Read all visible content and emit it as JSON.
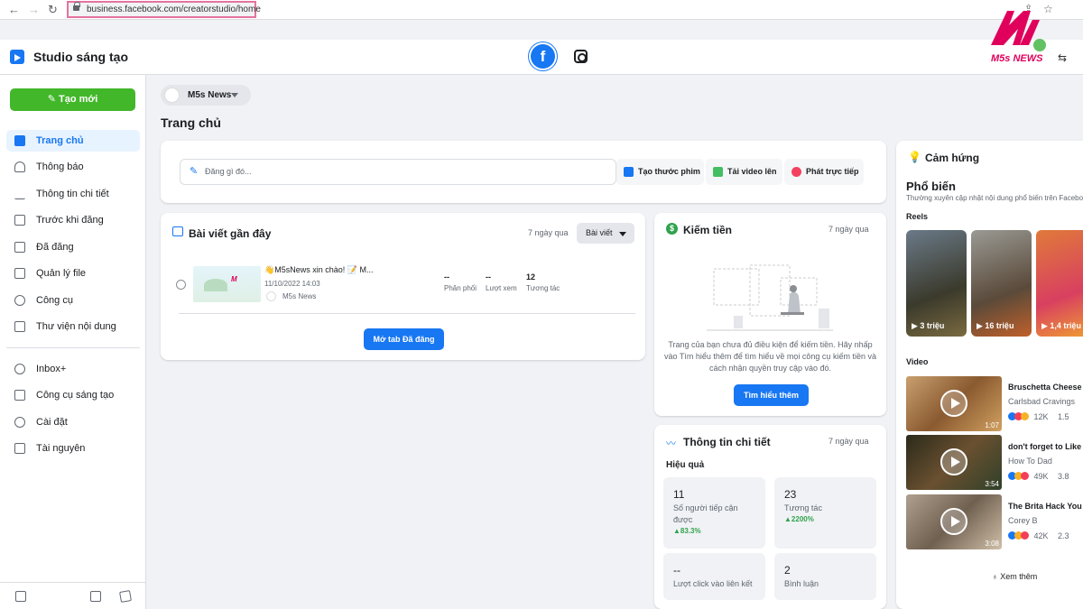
{
  "browser": {
    "url": "business.facebook.com/creatorstudio/home"
  },
  "header": {
    "title": "Studio sáng tạo",
    "brand": "M5s NEWS"
  },
  "sidebar": {
    "create_label": "Tạo mới",
    "items": [
      {
        "label": "Trang chủ",
        "icon": "home-icon"
      },
      {
        "label": "Thông báo",
        "icon": "bell-icon"
      },
      {
        "label": "Thông tin chi tiết",
        "icon": "chart-line-icon"
      },
      {
        "label": "Trước khi đăng",
        "icon": "document-icon"
      },
      {
        "label": "Đã đăng",
        "icon": "calendar-icon"
      },
      {
        "label": "Quản lý file",
        "icon": "file-icon"
      },
      {
        "label": "Công cụ",
        "icon": "tools-icon"
      },
      {
        "label": "Thư viện nội dung",
        "icon": "library-icon"
      },
      {
        "label": "Inbox+",
        "icon": "inbox-icon"
      },
      {
        "label": "Công cụ sáng tạo",
        "icon": "creative-tools-icon"
      },
      {
        "label": "Cài đặt",
        "icon": "gear-icon"
      },
      {
        "label": "Tài nguyên",
        "icon": "resources-icon"
      }
    ]
  },
  "page_selector": {
    "name": "M5s News"
  },
  "page_title": "Trang chủ",
  "compose": {
    "placeholder": "Đăng gì đó...",
    "actions": [
      "Tạo thước phim",
      "Tải video lên",
      "Phát trực tiếp"
    ]
  },
  "recent_posts": {
    "title": "Bài viết gần đây",
    "range": "7 ngày qua",
    "type_select": "Bài viết",
    "post": {
      "text": "👋M5sNews xin chào! 📝 M...",
      "date": "11/10/2022 14:03",
      "page": "M5s News",
      "stats": [
        {
          "value": "--",
          "label": "Phân phối"
        },
        {
          "value": "--",
          "label": "Lượt xem"
        },
        {
          "value": "12",
          "label": "Tương tác"
        }
      ]
    },
    "open_button": "Mở tab Đã đăng"
  },
  "monetize": {
    "title": "Kiếm tiền",
    "range": "7 ngày qua",
    "message": "Trang của bạn chưa đủ điều kiện để kiếm tiền. Hãy nhấp vào Tìm hiểu thêm để tìm hiểu về mọi công cụ kiếm tiền và cách nhận quyền truy cập vào đó.",
    "button": "Tìm hiểu thêm"
  },
  "insights": {
    "title": "Thông tin chi tiết",
    "range": "7 ngày qua",
    "section": "Hiệu quả",
    "stats": [
      {
        "value": "11",
        "label": "Số người tiếp cận được",
        "change": "83.3%"
      },
      {
        "value": "23",
        "label": "Tương tác",
        "change": "2200%"
      },
      {
        "value": "--",
        "label": "Lượt click vào liên kết",
        "change": ""
      },
      {
        "value": "2",
        "label": "Bình luận",
        "change": ""
      }
    ]
  },
  "inspiration": {
    "title": "Cảm hứng",
    "popular": "Phổ biến",
    "subtitle": "Thường xuyên cập nhật nội dung phổ biến trên Facebook",
    "reels_label": "Reels",
    "reels": [
      {
        "views": "3 triệu"
      },
      {
        "views": "16 triệu"
      },
      {
        "views": "1,4 triệu"
      }
    ],
    "video_label": "Video",
    "videos": [
      {
        "title": "Bruschetta Cheese B",
        "channel": "Carlsbad Cravings",
        "reactions": "12K",
        "other": "1.5",
        "duration": "1:07"
      },
      {
        "title": "don't forget to Like o",
        "channel": "How To Dad",
        "reactions": "49K",
        "other": "3.8",
        "duration": "3:54"
      },
      {
        "title": "The Brita Hack You",
        "channel": "Corey B",
        "reactions": "42K",
        "other": "2.3",
        "duration": "3:08"
      }
    ],
    "more": "Xem thêm"
  },
  "colors": {
    "primary": "#1877f2",
    "create": "#42b72a",
    "brand": "#e0005c"
  }
}
